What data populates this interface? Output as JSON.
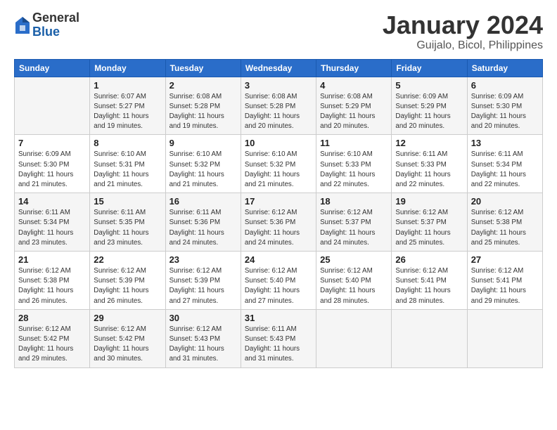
{
  "header": {
    "logo_general": "General",
    "logo_blue": "Blue",
    "title": "January 2024",
    "subtitle": "Guijalo, Bicol, Philippines"
  },
  "days_of_week": [
    "Sunday",
    "Monday",
    "Tuesday",
    "Wednesday",
    "Thursday",
    "Friday",
    "Saturday"
  ],
  "weeks": [
    [
      {
        "day": "",
        "info": ""
      },
      {
        "day": "1",
        "info": "Sunrise: 6:07 AM\nSunset: 5:27 PM\nDaylight: 11 hours\nand 19 minutes."
      },
      {
        "day": "2",
        "info": "Sunrise: 6:08 AM\nSunset: 5:28 PM\nDaylight: 11 hours\nand 19 minutes."
      },
      {
        "day": "3",
        "info": "Sunrise: 6:08 AM\nSunset: 5:28 PM\nDaylight: 11 hours\nand 20 minutes."
      },
      {
        "day": "4",
        "info": "Sunrise: 6:08 AM\nSunset: 5:29 PM\nDaylight: 11 hours\nand 20 minutes."
      },
      {
        "day": "5",
        "info": "Sunrise: 6:09 AM\nSunset: 5:29 PM\nDaylight: 11 hours\nand 20 minutes."
      },
      {
        "day": "6",
        "info": "Sunrise: 6:09 AM\nSunset: 5:30 PM\nDaylight: 11 hours\nand 20 minutes."
      }
    ],
    [
      {
        "day": "7",
        "info": "Sunrise: 6:09 AM\nSunset: 5:30 PM\nDaylight: 11 hours\nand 21 minutes."
      },
      {
        "day": "8",
        "info": "Sunrise: 6:10 AM\nSunset: 5:31 PM\nDaylight: 11 hours\nand 21 minutes."
      },
      {
        "day": "9",
        "info": "Sunrise: 6:10 AM\nSunset: 5:32 PM\nDaylight: 11 hours\nand 21 minutes."
      },
      {
        "day": "10",
        "info": "Sunrise: 6:10 AM\nSunset: 5:32 PM\nDaylight: 11 hours\nand 21 minutes."
      },
      {
        "day": "11",
        "info": "Sunrise: 6:10 AM\nSunset: 5:33 PM\nDaylight: 11 hours\nand 22 minutes."
      },
      {
        "day": "12",
        "info": "Sunrise: 6:11 AM\nSunset: 5:33 PM\nDaylight: 11 hours\nand 22 minutes."
      },
      {
        "day": "13",
        "info": "Sunrise: 6:11 AM\nSunset: 5:34 PM\nDaylight: 11 hours\nand 22 minutes."
      }
    ],
    [
      {
        "day": "14",
        "info": "Sunrise: 6:11 AM\nSunset: 5:34 PM\nDaylight: 11 hours\nand 23 minutes."
      },
      {
        "day": "15",
        "info": "Sunrise: 6:11 AM\nSunset: 5:35 PM\nDaylight: 11 hours\nand 23 minutes."
      },
      {
        "day": "16",
        "info": "Sunrise: 6:11 AM\nSunset: 5:36 PM\nDaylight: 11 hours\nand 24 minutes."
      },
      {
        "day": "17",
        "info": "Sunrise: 6:12 AM\nSunset: 5:36 PM\nDaylight: 11 hours\nand 24 minutes."
      },
      {
        "day": "18",
        "info": "Sunrise: 6:12 AM\nSunset: 5:37 PM\nDaylight: 11 hours\nand 24 minutes."
      },
      {
        "day": "19",
        "info": "Sunrise: 6:12 AM\nSunset: 5:37 PM\nDaylight: 11 hours\nand 25 minutes."
      },
      {
        "day": "20",
        "info": "Sunrise: 6:12 AM\nSunset: 5:38 PM\nDaylight: 11 hours\nand 25 minutes."
      }
    ],
    [
      {
        "day": "21",
        "info": "Sunrise: 6:12 AM\nSunset: 5:38 PM\nDaylight: 11 hours\nand 26 minutes."
      },
      {
        "day": "22",
        "info": "Sunrise: 6:12 AM\nSunset: 5:39 PM\nDaylight: 11 hours\nand 26 minutes."
      },
      {
        "day": "23",
        "info": "Sunrise: 6:12 AM\nSunset: 5:39 PM\nDaylight: 11 hours\nand 27 minutes."
      },
      {
        "day": "24",
        "info": "Sunrise: 6:12 AM\nSunset: 5:40 PM\nDaylight: 11 hours\nand 27 minutes."
      },
      {
        "day": "25",
        "info": "Sunrise: 6:12 AM\nSunset: 5:40 PM\nDaylight: 11 hours\nand 28 minutes."
      },
      {
        "day": "26",
        "info": "Sunrise: 6:12 AM\nSunset: 5:41 PM\nDaylight: 11 hours\nand 28 minutes."
      },
      {
        "day": "27",
        "info": "Sunrise: 6:12 AM\nSunset: 5:41 PM\nDaylight: 11 hours\nand 29 minutes."
      }
    ],
    [
      {
        "day": "28",
        "info": "Sunrise: 6:12 AM\nSunset: 5:42 PM\nDaylight: 11 hours\nand 29 minutes."
      },
      {
        "day": "29",
        "info": "Sunrise: 6:12 AM\nSunset: 5:42 PM\nDaylight: 11 hours\nand 30 minutes."
      },
      {
        "day": "30",
        "info": "Sunrise: 6:12 AM\nSunset: 5:43 PM\nDaylight: 11 hours\nand 31 minutes."
      },
      {
        "day": "31",
        "info": "Sunrise: 6:11 AM\nSunset: 5:43 PM\nDaylight: 11 hours\nand 31 minutes."
      },
      {
        "day": "",
        "info": ""
      },
      {
        "day": "",
        "info": ""
      },
      {
        "day": "",
        "info": ""
      }
    ]
  ]
}
